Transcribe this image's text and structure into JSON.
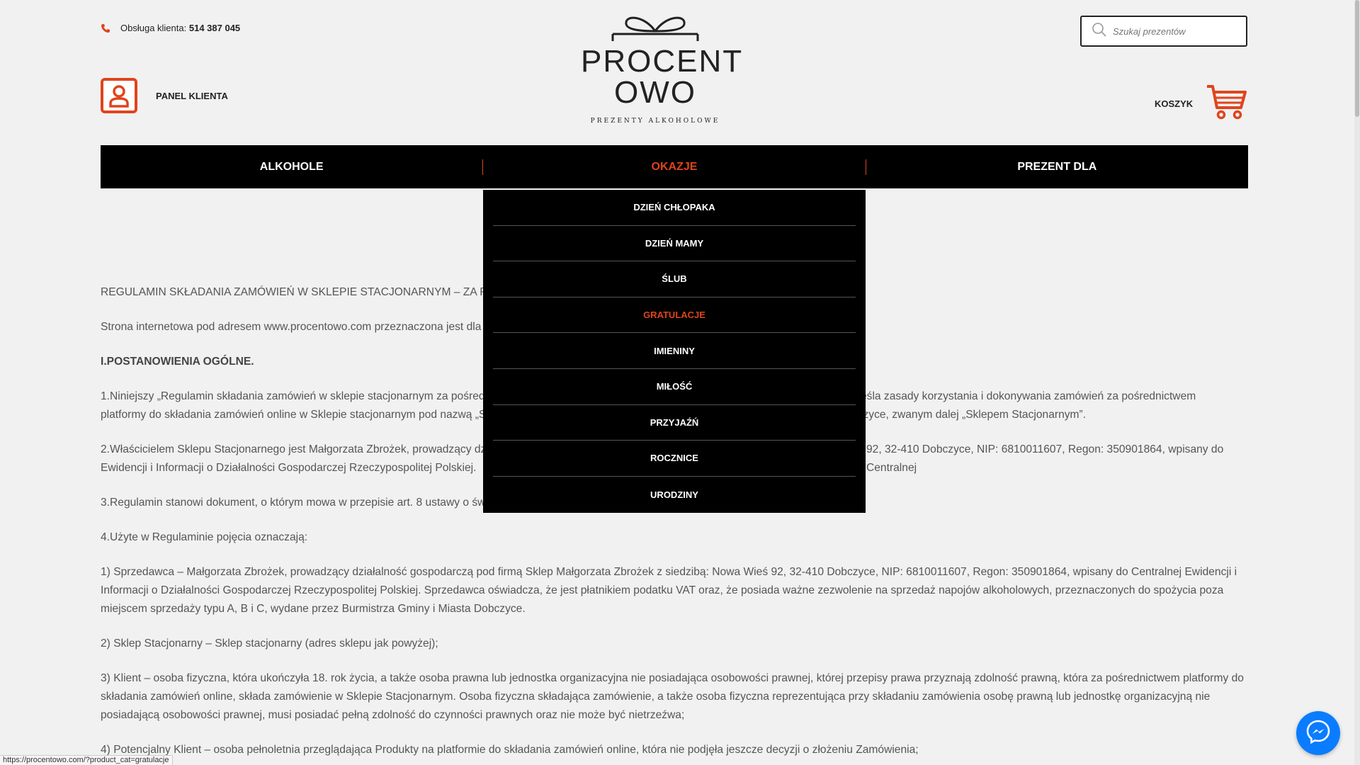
{
  "header": {
    "contact_label": "Obsługa klienta:",
    "contact_phone": "514 387 045",
    "panel_label": "PANEL KLIENTA",
    "logo": {
      "line1": "PROCENT",
      "line2": "OWO",
      "tagline": "PREZENTY ALKOHOLOWE"
    },
    "search_placeholder": "Szukaj prezentów",
    "cart_label": "KOSZYK"
  },
  "nav": {
    "items": [
      {
        "label": "ALKOHOLE"
      },
      {
        "label": "OKAZJE"
      },
      {
        "label": "PREZENT DLA"
      }
    ]
  },
  "dropdown": {
    "items": [
      {
        "label": "DZIEŃ CHŁOPAKA"
      },
      {
        "label": "DZIEŃ MAMY"
      },
      {
        "label": "ŚLUB"
      },
      {
        "label": "GRATULACJE"
      },
      {
        "label": "IMIENINY"
      },
      {
        "label": "MIŁOŚĆ"
      },
      {
        "label": "PRZYJAŹŃ"
      },
      {
        "label": "ROCZNICE"
      },
      {
        "label": "URODZINY"
      }
    ]
  },
  "content": {
    "p1": "REGULAMIN SKŁADANIA ZAMÓWIEŃ W SKLEPIE STACJONARNYM – ZA POŚREDNIC",
    "p2": "Strona internetowa pod adresem www.procentowo.com przeznaczona jest dla o",
    "h1": "I.POSTANOWIENIA OGÓLNE.",
    "p3a": "1.Niniejszy „Regulamin składania zamówień w sklepie stacjonarnym za pośredni",
    "p3b": "kreśla zasady korzystania i dokonywania zamówień za pośrednictwem",
    "p3c": "platformy do składania zamówień online w Sklepie stacjonarnym pod nazwą „Sk",
    "p3d": "bczyce, zwanym dalej „Sklepem Stacjonarnym”.",
    "p4a": "2.Właścicielem Sklepu Stacjonarnego jest Małgorzata Zbrożek, prowadzący dział",
    "p4b": "92, 32-410 Dobczyce, NIP: 6810011607, Regon: 350901864, wpisany do Centralnej",
    "p4c": "Ewidencji i Informacji o Działalności Gospodarczej Rzeczypospolitej Polskiej.",
    "p5": "3.Regulamin stanowi dokument, o którym mowa w przepisie art. 8 ustawy o świa",
    "p6": "4.Użyte w Regulaminie pojęcia oznaczają:",
    "p7": "1) Sprzedawca – Małgorzata Zbrożek, prowadzący działalność gospodarczą pod firmą Sklep Małgorzata Zbrożek z siedzibą: Nowa Wieś 92, 32-410 Dobczyce, NIP: 6810011607, Regon: 350901864, wpisany do Centralnej Ewidencji i Informacji o Działalności Gospodarczej Rzeczypospolitej Polskiej. Sprzedawca oświadcza, że jest płatnikiem podatku VAT oraz, że posiada ważne zezwolenie na sprzedaż napojów alkoholowych, przeznaczonych do spożycia poza miejscem sprzedaży typu A, B i C, wydane przez Burmistrza Gminy i Miasta Dobczyce.",
    "p8": "2) Sklep Stacjonarny – Sklep stacjonarny (adres sklepu jak powyżej);",
    "p9": "3) Klient – osoba fizyczna, która ukończyła 18. rok życia, a także osoba prawna lub jednostka organizacyjna nie posiadająca osobowości prawnej, której przepisy prawa przyznają zdolność prawną, która za pośrednictwem platformy do składania zamówień online, składa zamówienie w Sklepie Stacjonarnym. Osoba fizyczna składająca zamówienie, a także osoba fizyczna reprezentująca przy składaniu zamówienia osobę prawną lub jednostkę organizacyjną nie posiadającą osobowości prawnej, musi posiadać pełną zdolność do czynności prawnych oraz nie może być nietrzeźwa;",
    "p10": "4) Potencjalny Klient – osoba pełnoletnia przeglądająca Produkty na platformie do składania zamówień online, która nie podjęła jeszcze decyzji o złożeniu Zamówienia;"
  },
  "status_url": "https://procentowo.com/?product_cat=gratulacje",
  "colors": {
    "accent": "#e0441c",
    "nav_bg": "#000000",
    "messenger": "#0a7cff"
  }
}
